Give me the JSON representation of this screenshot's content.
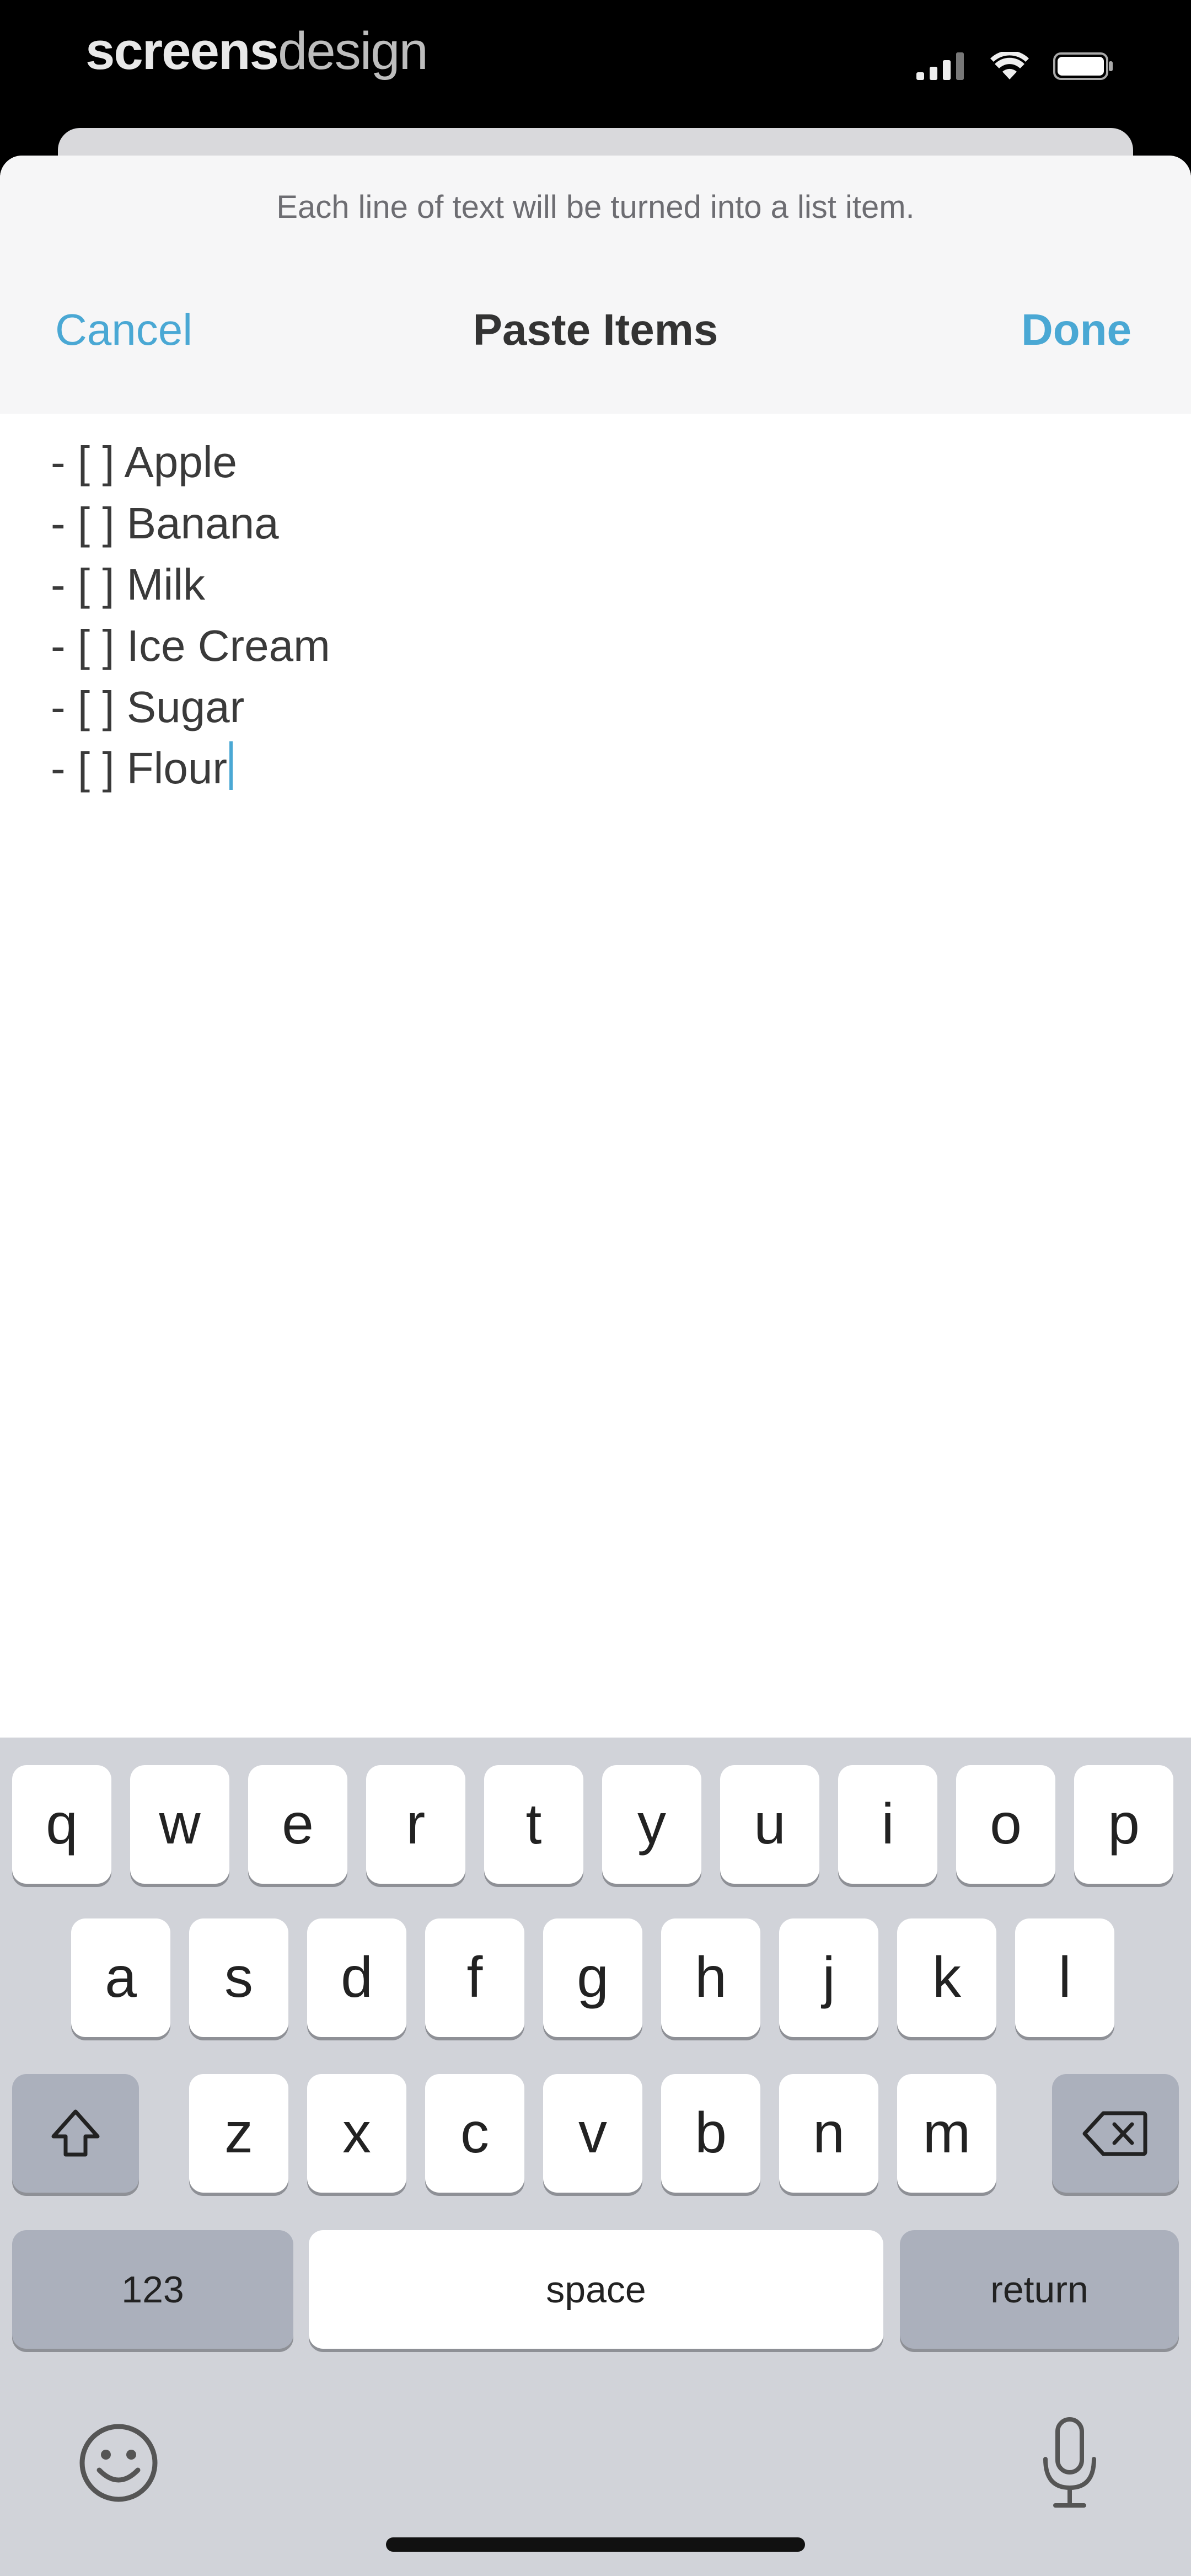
{
  "status_bar": {
    "brand_bold": "screens",
    "brand_light": "design",
    "icons": [
      "signal-bars",
      "wifi",
      "battery"
    ]
  },
  "sheet": {
    "hint": "Each line of text will be turned into a list item.",
    "cancel_label": "Cancel",
    "title": "Paste Items",
    "done_label": "Done",
    "lines": [
      "- [ ] Apple",
      "- [ ] Banana",
      "- [ ] Milk",
      "- [ ] Ice Cream",
      "- [ ] Sugar",
      "- [ ] Flour"
    ]
  },
  "keyboard": {
    "row1": [
      "q",
      "w",
      "e",
      "r",
      "t",
      "y",
      "u",
      "i",
      "o",
      "p"
    ],
    "row2": [
      "a",
      "s",
      "d",
      "f",
      "g",
      "h",
      "j",
      "k",
      "l"
    ],
    "row3": [
      "z",
      "x",
      "c",
      "v",
      "b",
      "n",
      "m"
    ],
    "numbers_label": "123",
    "space_label": "space",
    "return_label": "return",
    "icons": [
      "shift-icon",
      "delete-icon",
      "emoji-icon",
      "microphone-icon"
    ]
  },
  "colors": {
    "accent": "#4aa8d4",
    "keyboard_bg": "#d1d3d9",
    "dark_key": "#abb0bc"
  }
}
